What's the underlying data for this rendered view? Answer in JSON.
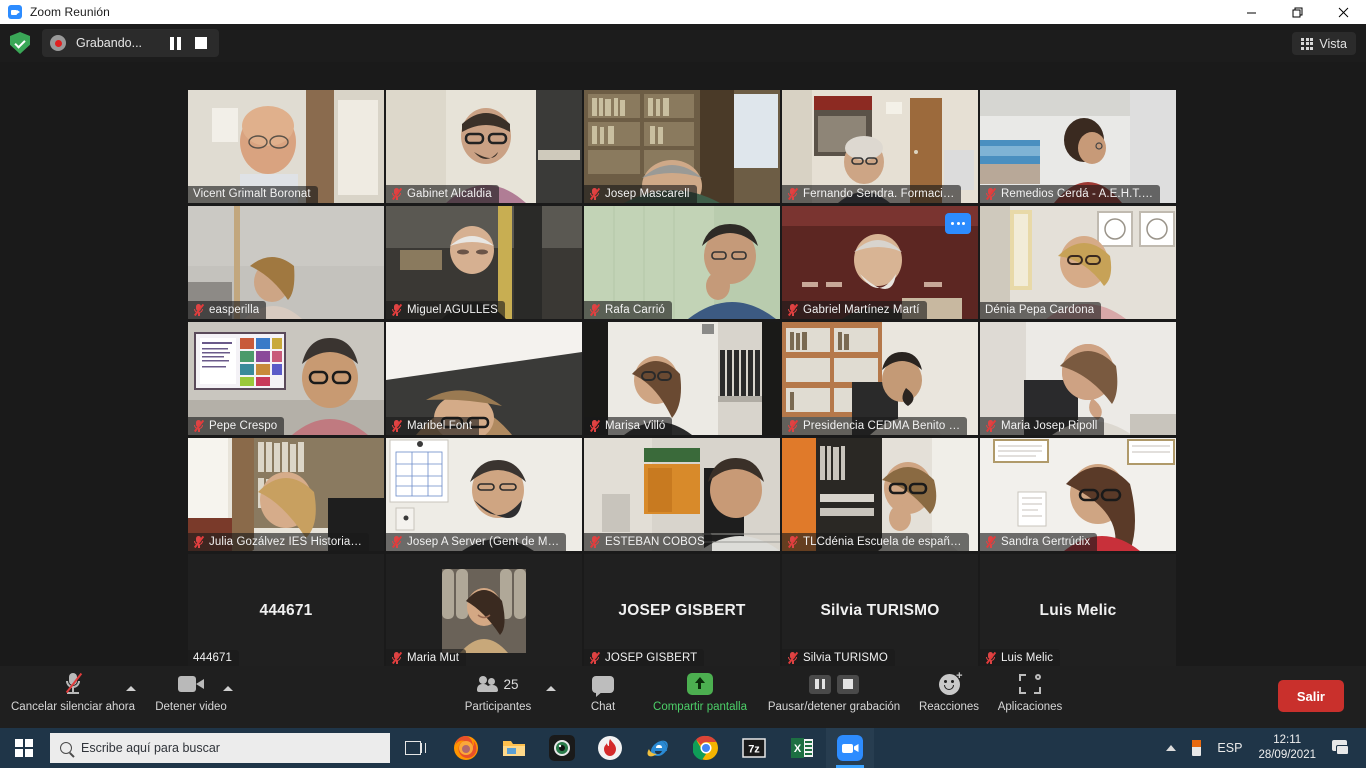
{
  "window": {
    "title": "Zoom Reunión",
    "app_icon": "zoom-camera-icon",
    "minimize": "—",
    "restore": "❐",
    "close": "✕"
  },
  "zoom_header": {
    "encryption_icon": "shield-check-icon",
    "recording_label": "Grabando...",
    "record_dot_icon": "record-dot-icon",
    "pause_icon": "pause-icon",
    "stop_icon": "stop-icon",
    "view_button": {
      "label": "Vista",
      "icon": "grid-view-icon"
    }
  },
  "gallery": {
    "more_options_icon": "ellipsis-icon",
    "mute_icon": "microphone-muted-icon",
    "participants": [
      {
        "name": "Vicent Grimalt Boronat",
        "muted": false,
        "speaking": true,
        "kind": "video",
        "bg": "room-bookshelf-light"
      },
      {
        "name": "Gabinet Alcaldia",
        "muted": true,
        "speaking": false,
        "kind": "video",
        "bg": "room-curtain"
      },
      {
        "name": "Josep Mascarell",
        "muted": true,
        "speaking": false,
        "kind": "video",
        "bg": "library-shelves"
      },
      {
        "name": "Fernando Sendra. Formaci…",
        "muted": true,
        "speaking": false,
        "kind": "video",
        "bg": "office-door"
      },
      {
        "name": "Remedios Cerdá - A.E.H.T.…",
        "muted": true,
        "speaking": false,
        "kind": "video",
        "bg": "office-white"
      },
      {
        "name": "easperilla",
        "muted": true,
        "speaking": false,
        "kind": "video",
        "bg": "grey-wall"
      },
      {
        "name": "Miguel  AGULLES",
        "muted": true,
        "speaking": false,
        "kind": "video",
        "bg": "dark-room"
      },
      {
        "name": "Rafa Carrió",
        "muted": true,
        "speaking": false,
        "kind": "video",
        "bg": "green-wall"
      },
      {
        "name": "Gabriel Martínez Martí",
        "muted": true,
        "speaking": false,
        "kind": "video",
        "bg": "dark-wood-hall",
        "more": true
      },
      {
        "name": "Dénia Pepa Cardona",
        "muted": false,
        "speaking": false,
        "kind": "video",
        "bg": "framed-pictures"
      },
      {
        "name": "Pepe Crespo",
        "muted": true,
        "speaking": false,
        "kind": "video",
        "bg": "presentation-screen"
      },
      {
        "name": "Maribel Font",
        "muted": true,
        "speaking": false,
        "kind": "video",
        "bg": "ceiling-view"
      },
      {
        "name": "Marisa Villó",
        "muted": true,
        "speaking": false,
        "kind": "video",
        "bg": "office-binders"
      },
      {
        "name": "Presidencia CEDMA Benito …",
        "muted": true,
        "speaking": false,
        "kind": "video",
        "bg": "wood-shelves"
      },
      {
        "name": "Maria Josep Ripoll",
        "muted": true,
        "speaking": false,
        "kind": "video",
        "bg": "white-office"
      },
      {
        "name": "Julia Gozálvez IES Historia…",
        "muted": true,
        "speaking": false,
        "kind": "video",
        "bg": "home-bookshelf"
      },
      {
        "name": "Josep A Server (Gent de M…",
        "muted": true,
        "speaking": false,
        "kind": "video",
        "bg": "wall-calendar"
      },
      {
        "name": "ESTEBAN COBOS",
        "muted": true,
        "speaking": false,
        "kind": "video",
        "bg": "office-cabinet"
      },
      {
        "name": "TLCdénia Escuela de españ…",
        "muted": true,
        "speaking": false,
        "kind": "video",
        "bg": "orange-wall-shelf"
      },
      {
        "name": "Sandra Gertrúdix",
        "muted": true,
        "speaking": false,
        "kind": "video",
        "bg": "white-wall-frames"
      },
      {
        "name": "444671",
        "muted": false,
        "speaking": false,
        "kind": "name",
        "display": "444671"
      },
      {
        "name": "Maria Mut",
        "muted": true,
        "speaking": false,
        "kind": "photo",
        "display": "Maria Mut"
      },
      {
        "name": "JOSEP GISBERT",
        "muted": true,
        "speaking": false,
        "kind": "name",
        "display": "JOSEP GISBERT"
      },
      {
        "name": "Silvia TURISMO",
        "muted": true,
        "speaking": false,
        "kind": "name",
        "display": "Silvia TURISMO"
      },
      {
        "name": "Luis Melic",
        "muted": true,
        "speaking": false,
        "kind": "name",
        "display": "Luis Melic"
      }
    ]
  },
  "toolbar": {
    "mute_label": "Cancelar silenciar ahora",
    "video_label": "Detener video",
    "participants_label": "Participantes",
    "participants_count": "25",
    "chat_label": "Chat",
    "share_label": "Compartir pantalla",
    "recording_label": "Pausar/detener grabación",
    "reactions_label": "Reacciones",
    "apps_label": "Aplicaciones",
    "leave_label": "Salir",
    "share_color": "#4ccf68",
    "leave_color": "#c9302c"
  },
  "taskbar": {
    "start_icon": "windows-start-icon",
    "search_placeholder": "Escribe aquí para buscar",
    "search_icon": "search-icon",
    "task_view_icon": "task-view-icon",
    "apps": [
      {
        "name": "firefox-icon"
      },
      {
        "name": "file-explorer-icon"
      },
      {
        "name": "camera-app-icon"
      },
      {
        "name": "flame-app-icon"
      },
      {
        "name": "internet-explorer-icon"
      },
      {
        "name": "chrome-icon"
      },
      {
        "name": "7zip-icon"
      },
      {
        "name": "excel-icon"
      },
      {
        "name": "zoom-icon",
        "active": true
      }
    ],
    "tray": {
      "chevron_icon": "chevron-up-icon",
      "battery_icon": "battery-icon",
      "language": "ESP",
      "time": "12:11",
      "date": "28/09/2021",
      "notification_icon": "notification-icon"
    }
  }
}
